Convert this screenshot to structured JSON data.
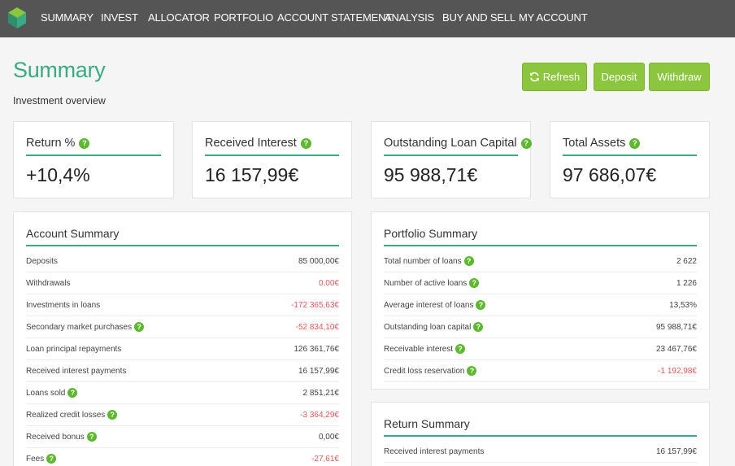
{
  "nav": {
    "items": [
      "SUMMARY",
      "INVEST",
      "ALLOCATOR",
      "PORTFOLIO",
      "ACCOUNT STATEMENT",
      "ANALYSIS",
      "BUY AND SELL",
      "MY ACCOUNT"
    ]
  },
  "header": {
    "title": "Summary",
    "subtitle": "Investment overview",
    "refresh_label": "Refresh",
    "deposit_label": "Deposit",
    "withdraw_label": "Withdraw"
  },
  "stats": [
    {
      "label": "Return %",
      "value": "+10,4%"
    },
    {
      "label": "Received Interest",
      "value": "16 157,99€"
    },
    {
      "label": "Outstanding Loan Capital",
      "value": "95 988,71€"
    },
    {
      "label": "Total Assets",
      "value": "97 686,07€"
    }
  ],
  "account_summary": {
    "title": "Account Summary",
    "rows": [
      {
        "label": "Deposits",
        "value": "85 000,00€",
        "help": false,
        "negative": false
      },
      {
        "label": "Withdrawals",
        "value": "0,00€",
        "help": false,
        "negative": true
      },
      {
        "label": "Investments in loans",
        "value": "-172 365,63€",
        "help": false,
        "negative": true
      },
      {
        "label": "Secondary market purchases",
        "value": "-52 834,10€",
        "help": true,
        "negative": true
      },
      {
        "label": "Loan principal repayments",
        "value": "126 361,76€",
        "help": false,
        "negative": false
      },
      {
        "label": "Received interest payments",
        "value": "16 157,99€",
        "help": false,
        "negative": false
      },
      {
        "label": "Loans sold",
        "value": "2 851,21€",
        "help": true,
        "negative": false
      },
      {
        "label": "Realized credit losses",
        "value": "-3 364,29€",
        "help": true,
        "negative": true
      },
      {
        "label": "Received bonus",
        "value": "0,00€",
        "help": true,
        "negative": false
      },
      {
        "label": "Fees",
        "value": "-27,61€",
        "help": true,
        "negative": true
      }
    ]
  },
  "portfolio_summary": {
    "title": "Portfolio Summary",
    "rows": [
      {
        "label": "Total number of loans",
        "value": "2 622",
        "help": true,
        "negative": false
      },
      {
        "label": "Number of active loans",
        "value": "1 226",
        "help": true,
        "negative": false
      },
      {
        "label": "Average interest of loans",
        "value": "13,53%",
        "help": true,
        "negative": false
      },
      {
        "label": "Outstanding loan capital",
        "value": "95 988,71€",
        "help": true,
        "negative": false
      },
      {
        "label": "Receivable interest",
        "value": "23 467,76€",
        "help": true,
        "negative": false
      },
      {
        "label": "Credit loss reservation",
        "value": "-1 192,98€",
        "help": true,
        "negative": true
      }
    ]
  },
  "return_summary": {
    "title": "Return Summary",
    "rows": [
      {
        "label": "Received interest payments",
        "value": "16 157,99€",
        "help": false,
        "negative": false
      }
    ]
  },
  "colors": {
    "nav_bg": "#555556",
    "accent": "#3aaa85",
    "button": "#8cc63f",
    "help_icon": "#5cb82e",
    "negative": "#e05a5a"
  },
  "icons": [
    "logo-cube-icon",
    "refresh-icon",
    "help-icon"
  ]
}
